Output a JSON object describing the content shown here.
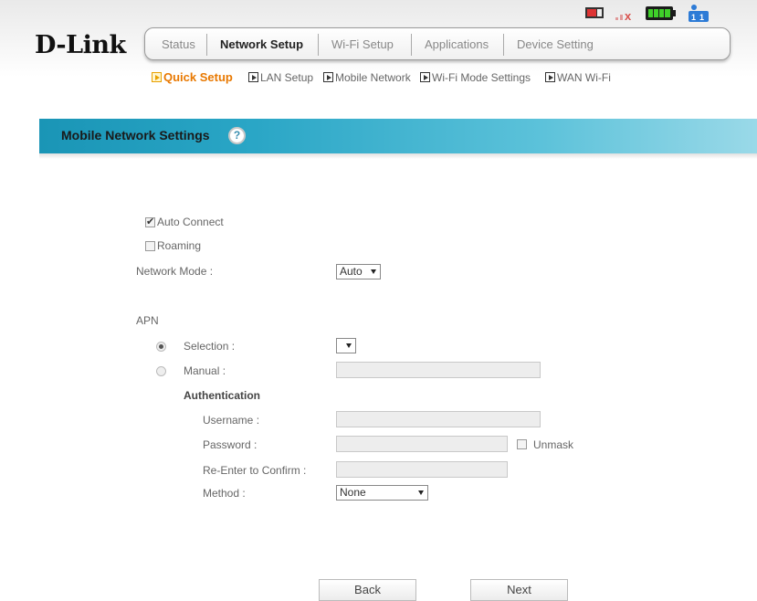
{
  "brand": {
    "logo_text": "D-Link"
  },
  "nav": {
    "tabs": [
      {
        "label": "Status"
      },
      {
        "label": "Network Setup"
      },
      {
        "label": "Wi-Fi Setup"
      },
      {
        "label": "Applications"
      },
      {
        "label": "Device Setting"
      }
    ],
    "active_tab": "Network Setup"
  },
  "status_icons": [
    "sms-icon",
    "signal-no-service-icon",
    "battery-full-icon",
    "network-info-icon"
  ],
  "subnav": {
    "items": [
      {
        "label": "Quick Setup"
      },
      {
        "label": "LAN Setup"
      },
      {
        "label": "Mobile Network"
      },
      {
        "label": "Wi-Fi Mode Settings"
      },
      {
        "label": "WAN Wi-Fi"
      }
    ],
    "active_item": "Quick Setup"
  },
  "page": {
    "title": "Mobile Network Settings",
    "help_glyph": "?"
  },
  "form": {
    "auto_connect": {
      "label": "Auto Connect",
      "checked": true
    },
    "roaming": {
      "label": "Roaming",
      "checked": false
    },
    "network_mode": {
      "label": "Network Mode :",
      "value": "Auto"
    },
    "apn": {
      "section_label": "APN",
      "selection": {
        "label": "Selection :",
        "value": "",
        "checked": true
      },
      "manual": {
        "label": "Manual :",
        "value": "",
        "checked": false
      }
    },
    "authentication": {
      "section_label": "Authentication",
      "username": {
        "label": "Username :",
        "value": ""
      },
      "password": {
        "label": "Password :",
        "value": ""
      },
      "unmask": {
        "label": "Unmask",
        "checked": false
      },
      "confirm": {
        "label": "Re-Enter to Confirm :",
        "value": ""
      },
      "method": {
        "label": "Method :",
        "value": "None"
      }
    }
  },
  "buttons": {
    "back": "Back",
    "next": "Next"
  },
  "colors": {
    "banner": "#2aa6c6",
    "active_subnav": "#e87800"
  }
}
